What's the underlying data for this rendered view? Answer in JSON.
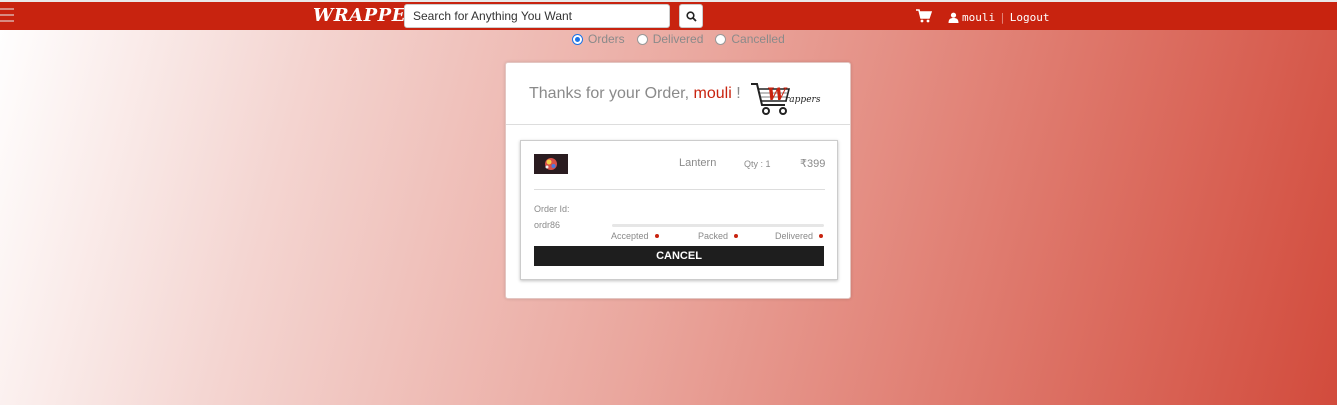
{
  "header": {
    "brand": "WRAPPERS",
    "search_placeholder": "Search for Anything You Want",
    "username": "mouli",
    "logout_label": "Logout"
  },
  "filters": {
    "options": [
      {
        "label": "Orders",
        "selected": true
      },
      {
        "label": "Delivered",
        "selected": false
      },
      {
        "label": "Cancelled",
        "selected": false
      }
    ]
  },
  "confirmation": {
    "thanks_text": "Thanks for your Order,",
    "username": "mouli",
    "exclamation": "!",
    "logo_text": "rappers"
  },
  "order": {
    "product_name": "Lantern",
    "qty_label": "Qty : 1",
    "price": "₹399",
    "order_id_label": "Order Id:",
    "order_id_value": "ordr86",
    "stages": [
      "Accepted",
      "Packed",
      "Delivered"
    ],
    "cancel_label": "CANCEL"
  },
  "colors": {
    "brand_red": "#c8230f",
    "button_dark": "#1e1e1e"
  }
}
